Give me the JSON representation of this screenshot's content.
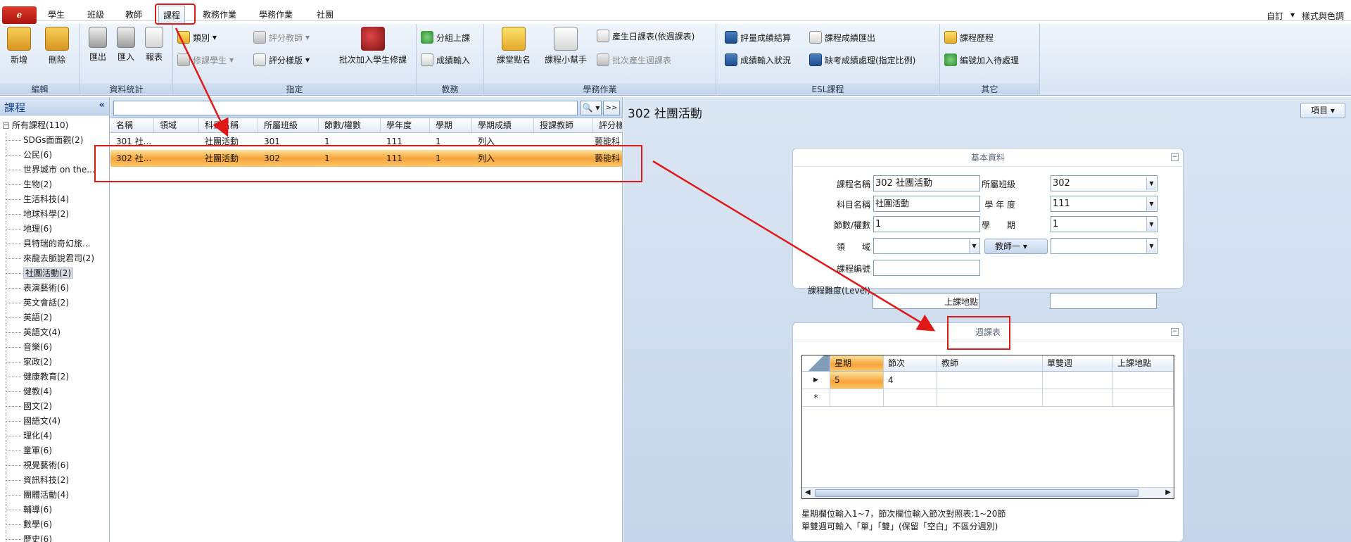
{
  "menubar": {
    "app_button": "ℯ",
    "tabs": [
      "學生",
      "班級",
      "教師",
      "課程",
      "教務作業",
      "學務作業",
      "社團"
    ],
    "active_tab": "課程",
    "right_items": [
      "自訂",
      "樣式與色調"
    ],
    "right_dropdown": "▾"
  },
  "ribbon": {
    "groups": {
      "edit": {
        "label": "編輯",
        "add": "新增",
        "delete": "刪除"
      },
      "data": {
        "label": "資料統計",
        "export": "匯出",
        "import": "匯入",
        "report": "報表"
      },
      "assign": {
        "label": "指定",
        "category": "類別",
        "eval_teacher": "評分教師",
        "enroll_students": "修課學生",
        "score_template": "評分樣版",
        "batch_add": "批次加入學生修課"
      },
      "academic": {
        "label": "教務",
        "group_class": "分組上課",
        "score_input": "成績輸入"
      },
      "student_affairs": {
        "label": "學務作業",
        "roll_call": "課堂點名",
        "helper": "課程小幫手",
        "daily_schedule": "產生日課表(依週課表)",
        "batch_weekly": "批次產生週課表"
      },
      "esl": {
        "label": "ESL課程",
        "eval_calc": "評量成績結算",
        "export_scores": "課程成績匯出",
        "input_status": "成績輸入狀況",
        "absence": "缺考成績處理(指定比例)"
      },
      "other": {
        "label": "其它",
        "history": "課程歷程",
        "add_pending": "編號加入待處理"
      }
    }
  },
  "left": {
    "title": "課程",
    "collapse": "«",
    "root": "所有課程(110)",
    "items": [
      "SDGs面面觀(2)",
      "公民(6)",
      "世界城市 on the...",
      "生物(2)",
      "生活科技(4)",
      "地球科學(2)",
      "地理(6)",
      "貝特瑞的奇幻旅...",
      "來龍去脈說君司(2)",
      "社團活動(2)",
      "表演藝術(6)",
      "英文會話(2)",
      "英語(2)",
      "英語文(4)",
      "音樂(6)",
      "家政(2)",
      "健康教育(2)",
      "健教(4)",
      "國文(2)",
      "國語文(4)",
      "理化(4)",
      "童軍(6)",
      "視覺藝術(6)",
      "資訊科技(2)",
      "團體活動(4)",
      "輔導(6)",
      "數學(6)",
      "歷史(6)"
    ],
    "selected": "社團活動(2)"
  },
  "list": {
    "search": {
      "value": "",
      "search_icon": "🔍 ▾",
      "more": ">>"
    },
    "columns": [
      "名稱",
      "領域",
      "科目名稱",
      "所屬班級",
      "節數/權數",
      "學年度",
      "學期",
      "學期成績",
      "授課教師",
      "評分樣"
    ],
    "rows": [
      [
        "301 社...",
        "",
        "社團活動",
        "301",
        "1",
        "111",
        "1",
        "列入",
        "",
        "藝能科"
      ],
      [
        "302 社...",
        "",
        "社團活動",
        "302",
        "1",
        "111",
        "1",
        "列入",
        "",
        "藝能科"
      ]
    ]
  },
  "detail": {
    "title": "302 社團活動",
    "items_button": "項目",
    "basic": {
      "section_title": "基本資料",
      "collapse": "⊟",
      "course_name_label": "課程名稱",
      "course_name": "302 社團活動",
      "class_label": "所屬班級",
      "class": "302",
      "subject_label": "科目名稱",
      "subject": "社團活動",
      "year_label": "學 年 度",
      "year": "111",
      "credits_label": "節數/權數",
      "credits": "1",
      "semester_label": "學　　期",
      "semester": "1",
      "domain_label": "領　　域",
      "domain": "",
      "teacher_button": "教師一",
      "teacher": "",
      "course_code_label": "課程編號",
      "course_code": "",
      "level_label": "課程難度(Level)",
      "level": "",
      "location_label": "上課地點",
      "location": ""
    },
    "weekly": {
      "section_title": "週課表",
      "collapse": "⊟",
      "columns": [
        "星期",
        "節次",
        "教師",
        "單雙週",
        "上課地點"
      ],
      "rows": [
        [
          "5",
          "4",
          "",
          "",
          ""
        ]
      ],
      "new_row_marker": "*",
      "current_row_marker": "▶",
      "notes": [
        "星期欄位輸入1~7，節次欄位輸入節次對照表:1~20節",
        "單雙週可輸入「單」「雙」(保留「空白」不區分週別)"
      ]
    }
  },
  "colors": {
    "accent": "#e01818",
    "selection": "#f7a43a",
    "ribbon": "#d9e5f3"
  }
}
